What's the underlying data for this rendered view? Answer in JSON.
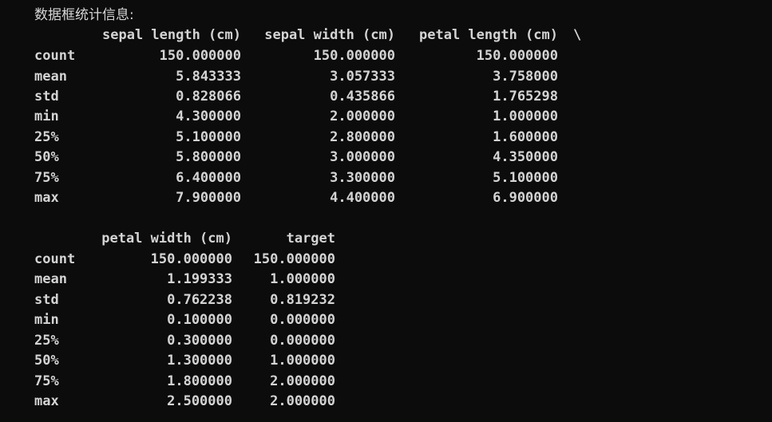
{
  "console": {
    "heading": "数据框统计信息:",
    "continuation_marker": "\\"
  },
  "block1": {
    "columns": [
      "sepal length (cm)",
      "sepal width (cm)",
      "petal length (cm)"
    ],
    "rows": [
      {
        "label": "count",
        "values": [
          "150.000000",
          "150.000000",
          "150.000000"
        ]
      },
      {
        "label": "mean",
        "values": [
          "5.843333",
          "3.057333",
          "3.758000"
        ]
      },
      {
        "label": "std",
        "values": [
          "0.828066",
          "0.435866",
          "1.765298"
        ]
      },
      {
        "label": "min",
        "values": [
          "4.300000",
          "2.000000",
          "1.000000"
        ]
      },
      {
        "label": "25%",
        "values": [
          "5.100000",
          "2.800000",
          "1.600000"
        ]
      },
      {
        "label": "50%",
        "values": [
          "5.800000",
          "3.000000",
          "4.350000"
        ]
      },
      {
        "label": "75%",
        "values": [
          "6.400000",
          "3.300000",
          "5.100000"
        ]
      },
      {
        "label": "max",
        "values": [
          "7.900000",
          "4.400000",
          "6.900000"
        ]
      }
    ]
  },
  "block2": {
    "columns": [
      "petal width (cm)",
      "target"
    ],
    "rows": [
      {
        "label": "count",
        "values": [
          "150.000000",
          "150.000000"
        ]
      },
      {
        "label": "mean",
        "values": [
          "1.199333",
          "1.000000"
        ]
      },
      {
        "label": "std",
        "values": [
          "0.762238",
          "0.819232"
        ]
      },
      {
        "label": "min",
        "values": [
          "0.100000",
          "0.000000"
        ]
      },
      {
        "label": "25%",
        "values": [
          "0.300000",
          "0.000000"
        ]
      },
      {
        "label": "50%",
        "values": [
          "1.300000",
          "1.000000"
        ]
      },
      {
        "label": "75%",
        "values": [
          "1.800000",
          "2.000000"
        ]
      },
      {
        "label": "max",
        "values": [
          "2.500000",
          "2.000000"
        ]
      }
    ]
  }
}
